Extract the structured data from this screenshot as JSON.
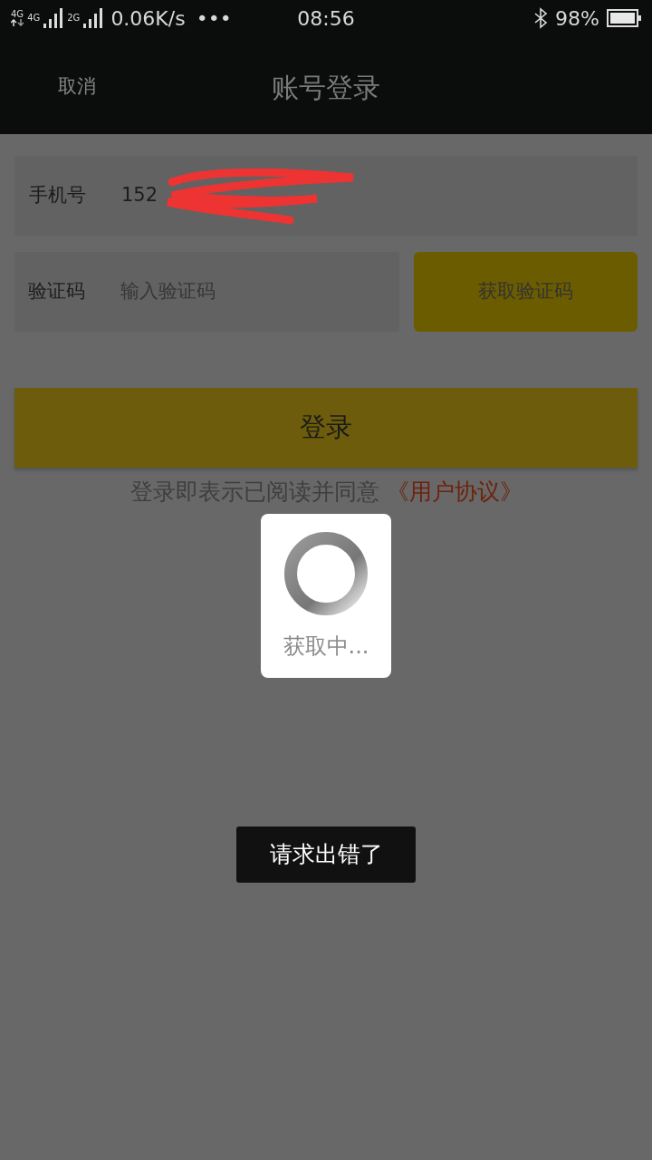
{
  "status_bar": {
    "networks": [
      {
        "label": "4G",
        "arrows": true
      },
      {
        "label": "4G",
        "arrows": false
      },
      {
        "label": "2G",
        "arrows": false
      }
    ],
    "speed": "0.06K/s",
    "more": "•••",
    "time": "08:56",
    "battery_text": "98%"
  },
  "header": {
    "cancel": "取消",
    "title": "账号登录"
  },
  "form": {
    "phone": {
      "label": "手机号",
      "value": "152",
      "redacted": true
    },
    "code": {
      "label": "验证码",
      "placeholder": "输入验证码"
    },
    "get_code_button": "获取验证码",
    "login_button": "登录",
    "agreement": {
      "text": "登录即表示已阅读并同意",
      "link": "《用户协议》"
    }
  },
  "loading_dialog": {
    "text": "获取中..."
  },
  "toast": {
    "text": "请求出错了"
  }
}
